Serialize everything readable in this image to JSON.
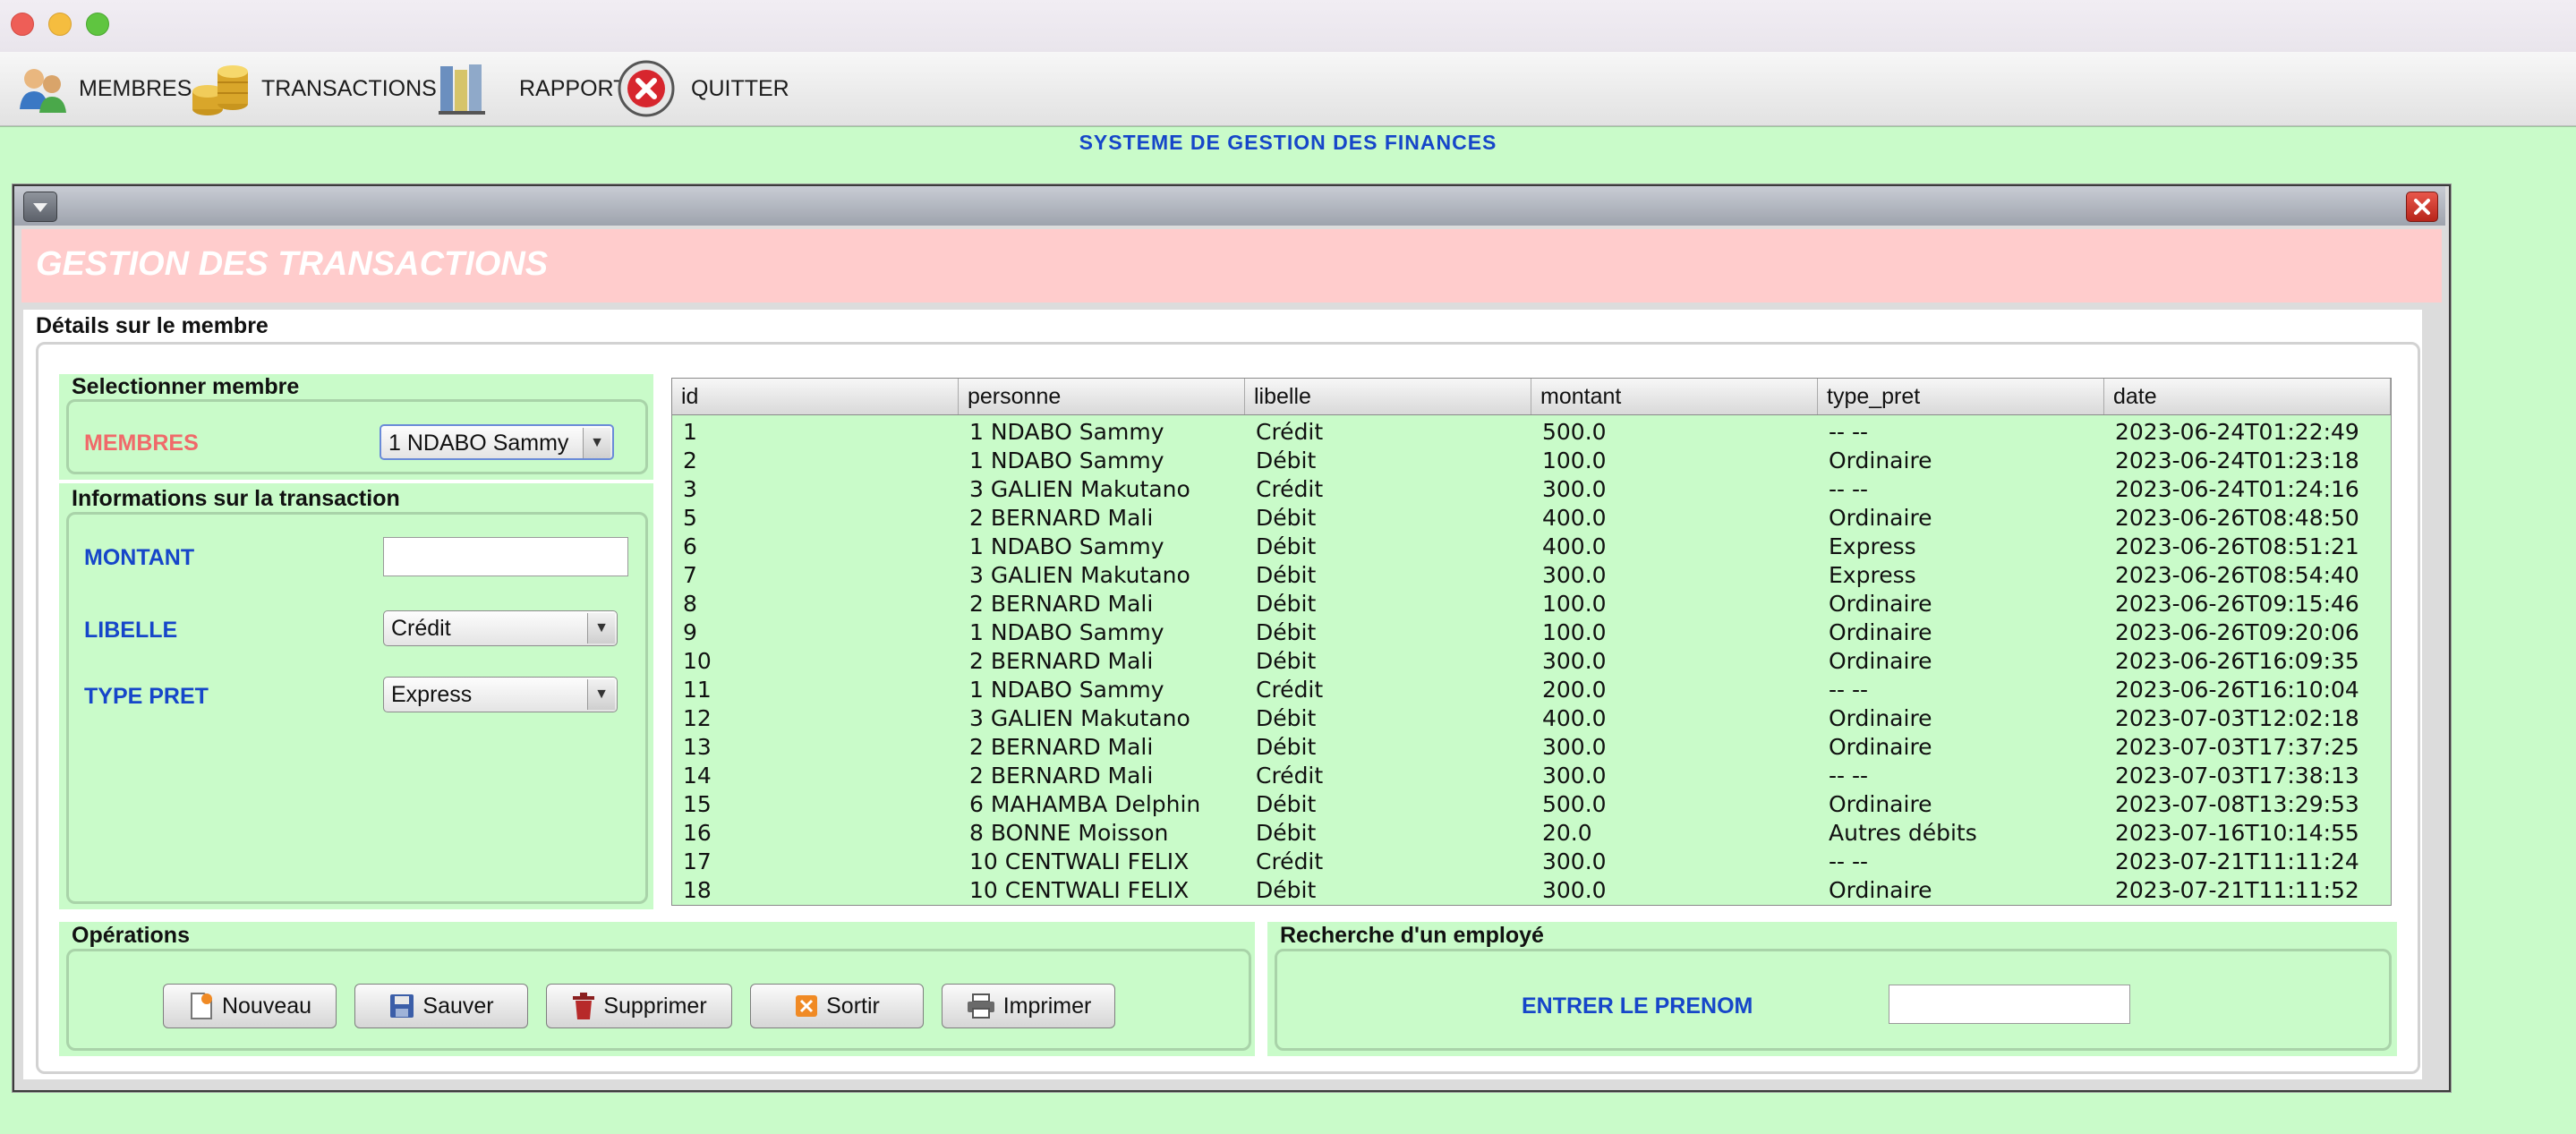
{
  "menu": {
    "membres": "MEMBRES",
    "transactions": "TRANSACTIONS",
    "rapports": "RAPPORTS",
    "quitter": "QUITTER"
  },
  "app": {
    "title": "SYSTEME DE GESTION DES FINANCES"
  },
  "frame": {
    "title": "GESTION DES TRANSACTIONS"
  },
  "details": {
    "label": "Détails sur le membre"
  },
  "select_member": {
    "label": "Selectionner membre",
    "field_label": "MEMBRES",
    "value": "1 NDABO Sammy"
  },
  "transaction_info": {
    "label": "Informations sur la transaction",
    "montant_label": "MONTANT",
    "montant_value": "",
    "libelle_label": "LIBELLE",
    "libelle_value": "Crédit",
    "type_pret_label": "TYPE PRET",
    "type_pret_value": "Express"
  },
  "table": {
    "columns": [
      "id",
      "personne",
      "libelle",
      "montant",
      "type_pret",
      "date"
    ],
    "rows": [
      [
        "1",
        "1 NDABO Sammy",
        "Crédit",
        "500.0",
        "-- --",
        "2023-06-24T01:22:49"
      ],
      [
        "2",
        "1 NDABO Sammy",
        "Débit",
        "100.0",
        "Ordinaire",
        "2023-06-24T01:23:18"
      ],
      [
        "3",
        "3 GALIEN Makutano",
        "Crédit",
        "300.0",
        "-- --",
        "2023-06-24T01:24:16"
      ],
      [
        "5",
        "2 BERNARD Mali",
        "Débit",
        "400.0",
        "Ordinaire",
        "2023-06-26T08:48:50"
      ],
      [
        "6",
        "1 NDABO Sammy",
        "Débit",
        "400.0",
        "Express",
        "2023-06-26T08:51:21"
      ],
      [
        "7",
        "3 GALIEN Makutano",
        "Débit",
        "300.0",
        "Express",
        "2023-06-26T08:54:40"
      ],
      [
        "8",
        "2 BERNARD Mali",
        "Débit",
        "100.0",
        "Ordinaire",
        "2023-06-26T09:15:46"
      ],
      [
        "9",
        "1 NDABO Sammy",
        "Débit",
        "100.0",
        "Ordinaire",
        "2023-06-26T09:20:06"
      ],
      [
        "10",
        "2 BERNARD Mali",
        "Débit",
        "300.0",
        "Ordinaire",
        "2023-06-26T16:09:35"
      ],
      [
        "11",
        "1 NDABO Sammy",
        "Crédit",
        "200.0",
        "-- --",
        "2023-06-26T16:10:04"
      ],
      [
        "12",
        "3 GALIEN Makutano",
        "Débit",
        "400.0",
        "Ordinaire",
        "2023-07-03T12:02:18"
      ],
      [
        "13",
        "2 BERNARD Mali",
        "Débit",
        "300.0",
        "Ordinaire",
        "2023-07-03T17:37:25"
      ],
      [
        "14",
        "2 BERNARD Mali",
        "Crédit",
        "300.0",
        "-- --",
        "2023-07-03T17:38:13"
      ],
      [
        "15",
        "6 MAHAMBA Delphin",
        "Débit",
        "500.0",
        "Ordinaire",
        "2023-07-08T13:29:53"
      ],
      [
        "16",
        "8 BONNE Moisson",
        "Débit",
        "20.0",
        "Autres débits",
        "2023-07-16T10:14:55"
      ],
      [
        "17",
        "10 CENTWALI FELIX",
        "Crédit",
        "300.0",
        "-- --",
        "2023-07-21T11:11:24"
      ],
      [
        "18",
        "10 CENTWALI FELIX",
        "Débit",
        "300.0",
        "Ordinaire",
        "2023-07-21T11:11:52"
      ]
    ]
  },
  "operations": {
    "label": "Opérations",
    "nouveau": "Nouveau",
    "sauver": "Sauver",
    "supprimer": "Supprimer",
    "sortir": "Sortir",
    "imprimer": "Imprimer"
  },
  "search": {
    "label": "Recherche d'un employé",
    "field_label": "ENTRER LE PRENOM",
    "value": ""
  },
  "colors": {
    "panel_green": "#c9fbc9",
    "banner_pink": "#ffcccc",
    "label_blue": "#1646c9",
    "label_red": "#f06a6a"
  }
}
